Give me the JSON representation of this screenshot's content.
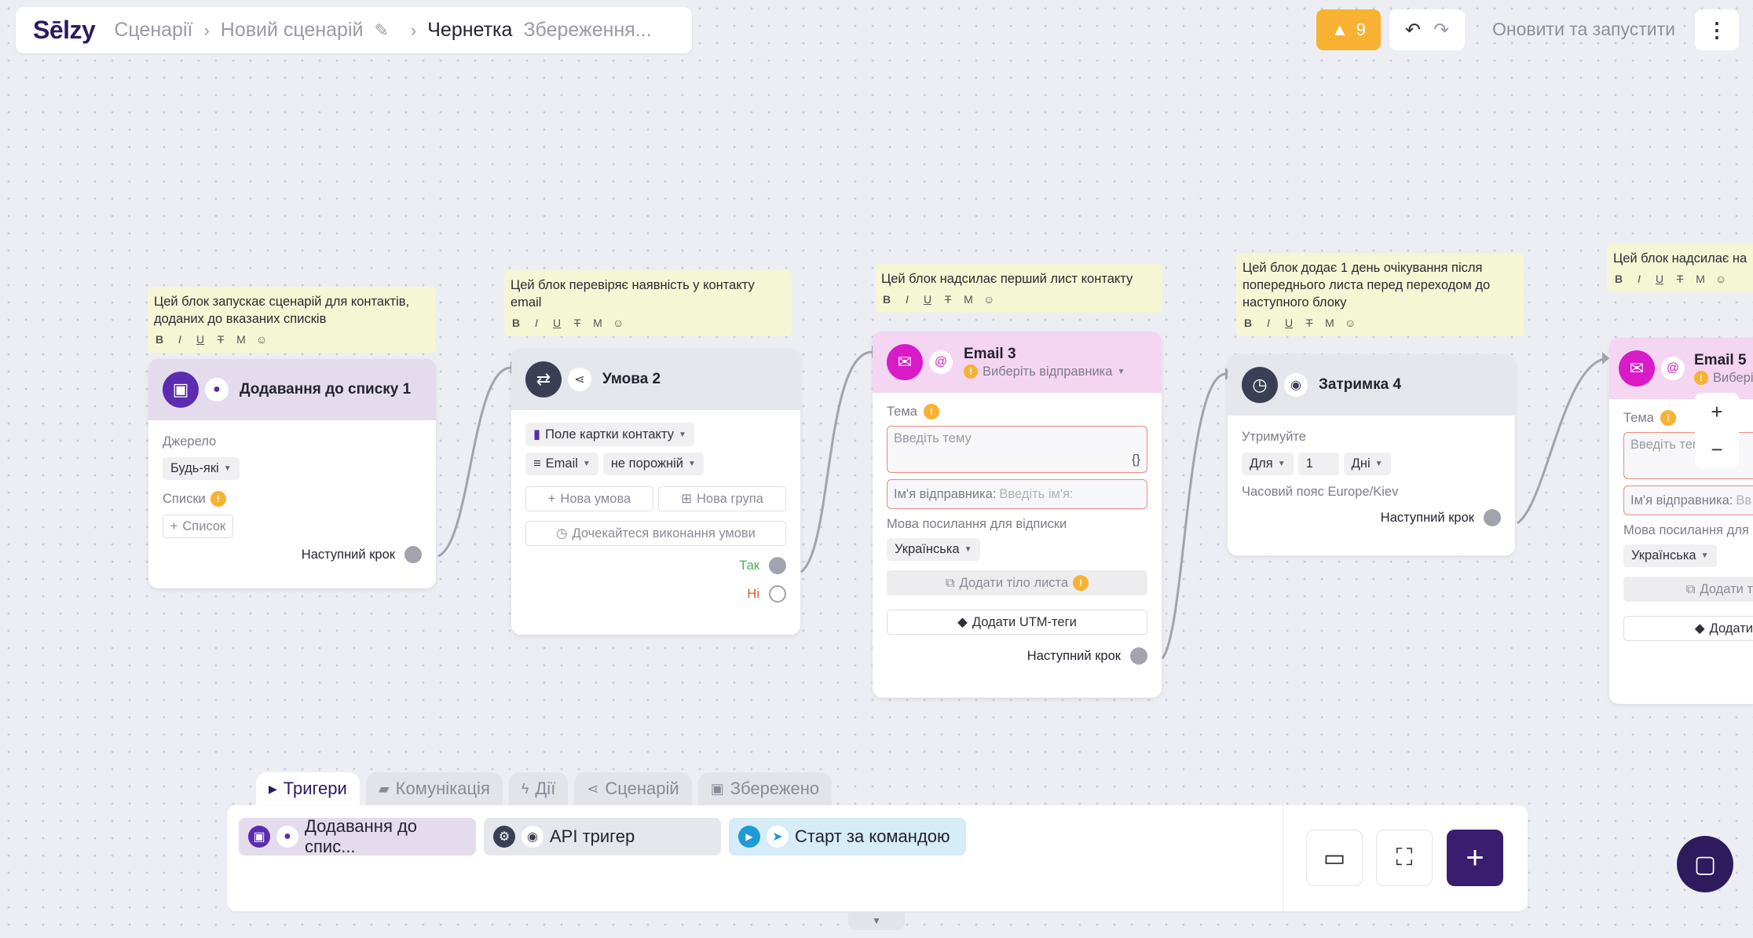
{
  "header": {
    "logo": "Sēlzy",
    "breadcrumb_1": "Сценарії",
    "breadcrumb_2": "Новий сценарій",
    "status": "Чернетка",
    "saving": "Збереження...",
    "warnings_count": "9",
    "run_label": "Оновити та запустити"
  },
  "notes": {
    "n1": "Цей блок запускає сценарій для контактів, доданих до вказаних списків",
    "n2": "Цей блок перевіряє наявність у контакту email",
    "n3": "Цей блок надсилає перший лист контакту",
    "n4": "Цей блок додає 1 день очікування після попереднього листа перед переходом до наступного блоку",
    "n5": "Цей блок надсилає на"
  },
  "card1": {
    "title": "Додавання до списку 1",
    "source_label": "Джерело",
    "source_value": "Будь-які",
    "lists_label": "Списки",
    "add_list": "Список",
    "next_step": "Наступний крок"
  },
  "card2": {
    "title": "Умова 2",
    "field_type": "Поле картки контакту",
    "field": "Email",
    "operator": "не порожній",
    "new_condition": "Нова умова",
    "new_group": "Нова група",
    "wait": "Дочекайтеся виконання умови",
    "yes": "Так",
    "no": "Ні"
  },
  "card3": {
    "title": "Email 3",
    "sender": "Виберіть відправника",
    "subject_label": "Тема",
    "subject_placeholder": "Введіть тему",
    "var_icon": "{}",
    "sender_name_label": "Ім'я відправника:",
    "sender_name_placeholder": "Введіть ім'я:",
    "unsub_lang_label": "Мова посилання для відписки",
    "lang_value": "Українська",
    "add_body": "Додати тіло листа",
    "add_utm": "Додати UTM-теги",
    "next_step": "Наступний крок"
  },
  "card4": {
    "title": "Затримка 4",
    "hold_label": "Утримуйте",
    "for": "Для",
    "amount": "1",
    "unit": "Дні",
    "timezone": "Часовий пояс Europe/Kiev",
    "next_step": "Наступний крок"
  },
  "card5": {
    "title": "Email 5",
    "sender": "Виберіт",
    "subject_label": "Тема",
    "subject_placeholder": "Введіть тем",
    "sender_name_label": "Ім'я відправника:",
    "sender_name_placeholder": "Вв",
    "unsub_lang_label": "Мова посилання для в",
    "lang_value": "Українська",
    "add_body": "Додати т",
    "add_utm": "Додати"
  },
  "tabs": [
    "Тригери",
    "Комунікація",
    "Дії",
    "Сценарій",
    "Збережено"
  ],
  "triggers": [
    "Додавання до спис...",
    "API тригер",
    "Старт за командою"
  ],
  "zoom": {
    "in": "+",
    "out": "−"
  },
  "colors": {
    "brand": "#3a1d6e",
    "warning": "#f8b131",
    "yes": "#4caf50",
    "no": "#e5533d"
  }
}
